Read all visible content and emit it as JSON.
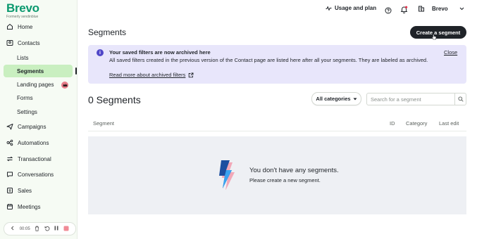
{
  "brand": {
    "name": "Brevo",
    "subtitle": "Formerly sendinblue",
    "color": "#0b996e"
  },
  "sidebar": {
    "items": [
      {
        "label": "Home",
        "icon": "home-icon"
      },
      {
        "label": "Contacts",
        "icon": "contacts-icon"
      },
      {
        "label": "Lists",
        "sub": true
      },
      {
        "label": "Segments",
        "sub": true,
        "active": true
      },
      {
        "label": "Landing pages",
        "sub": true,
        "badge_icon": "crown-icon"
      },
      {
        "label": "Forms",
        "sub": true
      },
      {
        "label": "Settings",
        "sub": true
      },
      {
        "label": "Campaigns",
        "icon": "send-icon"
      },
      {
        "label": "Automations",
        "icon": "automation-icon"
      },
      {
        "label": "Transactional",
        "icon": "transactional-icon"
      },
      {
        "label": "Conversations",
        "icon": "chat-icon"
      },
      {
        "label": "Sales",
        "icon": "sales-icon"
      },
      {
        "label": "Meetings",
        "icon": "calendar-icon"
      }
    ]
  },
  "recorder": {
    "time": "00:05"
  },
  "topbar": {
    "usage_label": "Usage and plan",
    "org_name": "Brevo"
  },
  "page": {
    "title": "Segments",
    "create_button": "Create a segment"
  },
  "info": {
    "title": "Your saved filters are now archived here",
    "body": "All saved filters created in the previous version of the Contact page are listed here after all your segments. They are labeled as archived.",
    "link": "Read more about archived filters",
    "close": "Close"
  },
  "segments": {
    "count_title": "0 Segments",
    "category_button": "All categories",
    "search_placeholder": "Search for a segment"
  },
  "table": {
    "columns": [
      "Segment",
      "ID",
      "Category",
      "Last edit"
    ]
  },
  "empty": {
    "title": "You don't have any segments.",
    "subtitle": "Please create a new segment."
  },
  "colors": {
    "sidebar_bg": "#f6fbf4",
    "active_item": "#c9efc0",
    "info_bg": "#e8e6fb",
    "info_icon": "#4f46c8",
    "primary_button": "#1f2328",
    "empty_bg": "#eef0f4"
  }
}
